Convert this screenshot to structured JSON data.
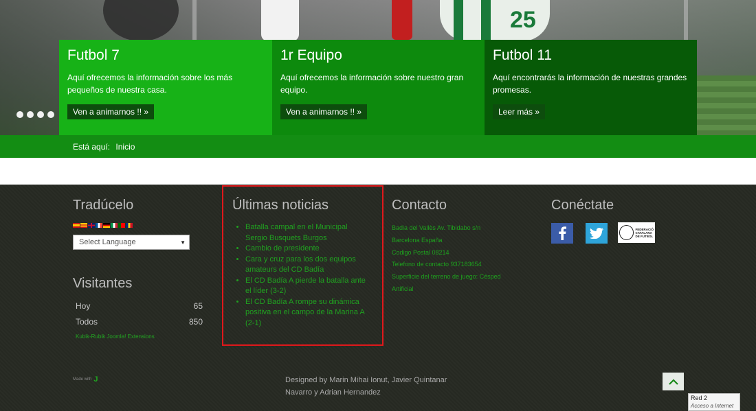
{
  "slider": {
    "dots": 4,
    "cards": [
      {
        "title": "Futbol 7",
        "text": "Aquí ofrecemos la información sobre los más pequeños de nuestra casa.",
        "button": "Ven a animarnos !! »",
        "color": "#17b217"
      },
      {
        "title": "1r Equipo",
        "text": "Aquí ofrecemos la información sobre nuestro gran equipo.",
        "button": "Ven a animarnos !! »",
        "color": "#0d8a0d"
      },
      {
        "title": "Futbol 11",
        "text": "Aquí encontrarás la información de nuestras grandes promesas.",
        "button": "Leer más »",
        "color": "#075a07"
      }
    ]
  },
  "breadcrumb": {
    "label": "Está aquí:",
    "current": "Inicio"
  },
  "footer": {
    "translate": {
      "title": "Tradúcelo",
      "select_label": "Select Language"
    },
    "visitors": {
      "title": "Visitantes",
      "rows": [
        {
          "label": "Hoy",
          "value": "65"
        },
        {
          "label": "Todos",
          "value": "850"
        }
      ],
      "credit": "Kubik-Rubik Joomla! Extensions"
    },
    "news": {
      "title": "Últimas noticias",
      "items": [
        "Batalla campal en el Municipal Sergio Busquets Burgos",
        "Cambio de presidente",
        "Cara y cruz para los dos equipos amateurs del CD Badía",
        "El CD Badía A pierde la batalla ante el líder (3-2)",
        "El CD Badía A rompe su dinámica positiva en el campo de la Marina A (2-1)"
      ]
    },
    "contact": {
      "title": "Contacto",
      "lines": [
        "Badia del Vallès Av. Tibidabo s/n",
        "Barcelona España",
        "Codigo Postal 08214",
        "Telefono de contacto 937183654",
        "Superficie del terreno de juego: Césped",
        "Artificial"
      ]
    },
    "social": {
      "title": "Conéctate",
      "fcf_text": [
        "FEDERACIÓ",
        "CATALANA",
        "DE FUTBOL"
      ]
    },
    "made_with": "Made with",
    "designed_by": "Designed by Marin Mihai Ionut, Javier Quintanar Navarro y Adrian Hernandez"
  },
  "status_popup": {
    "line1": "Red  2",
    "line2": "Acceso a Internet"
  },
  "colors": {
    "brand_green": "#138d13",
    "footer_bg": "#272a23",
    "link_green": "#20a020",
    "highlight_red": "#e0181b"
  }
}
